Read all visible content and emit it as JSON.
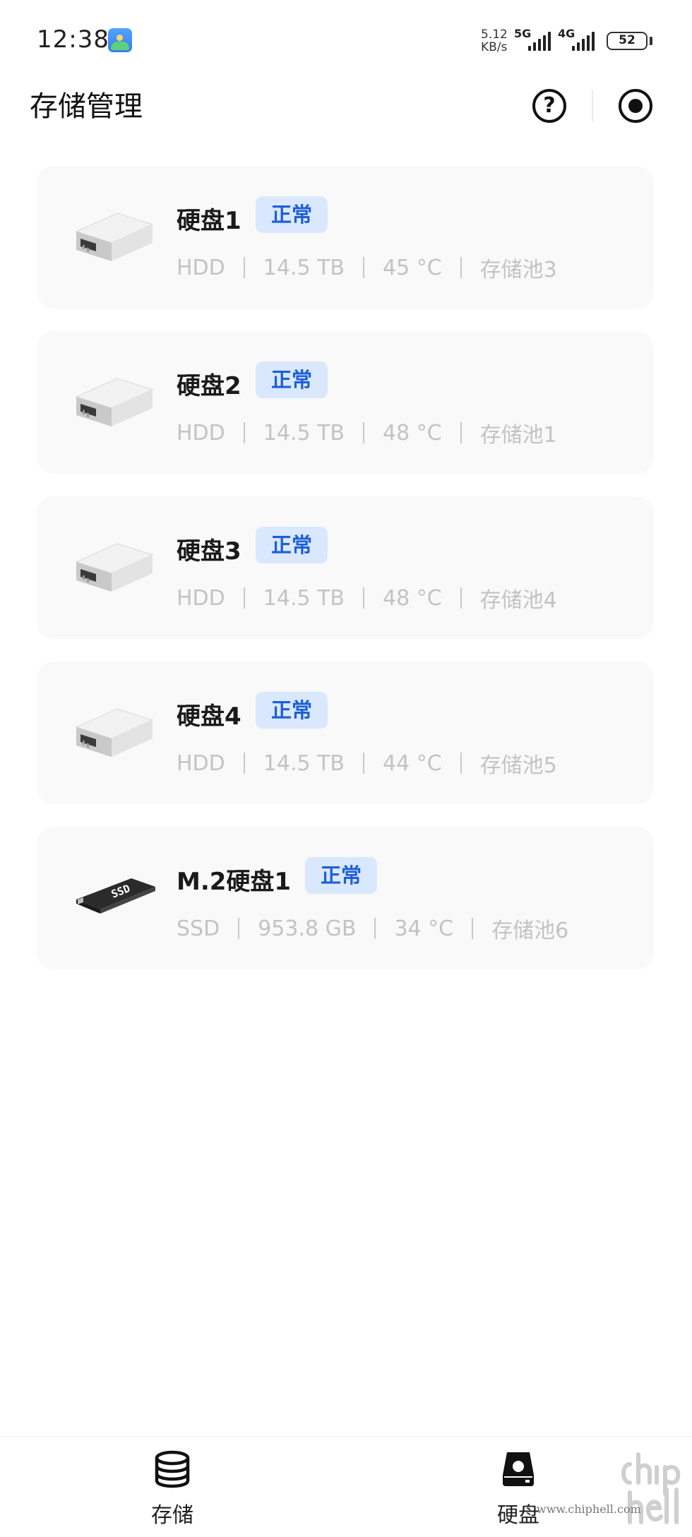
{
  "status_bar": {
    "time": "12:38",
    "net_speed_value": "5.12",
    "net_speed_unit": "KB/s",
    "sim1_label": "5G",
    "sim2_label": "4G",
    "battery": "52"
  },
  "header": {
    "title": "存储管理",
    "help_label": "?"
  },
  "disks": [
    {
      "name": "硬盘1",
      "status": "正常",
      "type": "HDD",
      "capacity": "14.5 TB",
      "temp": "45 °C",
      "pool": "存储池3",
      "kind": "hdd"
    },
    {
      "name": "硬盘2",
      "status": "正常",
      "type": "HDD",
      "capacity": "14.5 TB",
      "temp": "48 °C",
      "pool": "存储池1",
      "kind": "hdd"
    },
    {
      "name": "硬盘3",
      "status": "正常",
      "type": "HDD",
      "capacity": "14.5 TB",
      "temp": "48 °C",
      "pool": "存储池4",
      "kind": "hdd"
    },
    {
      "name": "硬盘4",
      "status": "正常",
      "type": "HDD",
      "capacity": "14.5 TB",
      "temp": "44 °C",
      "pool": "存储池5",
      "kind": "hdd"
    },
    {
      "name": "M.2硬盘1",
      "status": "正常",
      "type": "SSD",
      "capacity": "953.8 GB",
      "temp": "34 °C",
      "pool": "存储池6",
      "kind": "ssd"
    }
  ],
  "ssd_chip_text": "SSD",
  "tabs": [
    {
      "label": "存储",
      "icon": "database-icon"
    },
    {
      "label": "硬盘",
      "icon": "hard-drive-icon"
    }
  ],
  "watermark": {
    "url": "www.chiphell.com"
  },
  "colors": {
    "badge_bg": "#d9e8fd",
    "badge_text": "#1d5fd6",
    "card_bg": "#f9f9f9",
    "meta_text": "#c3c3c3"
  }
}
